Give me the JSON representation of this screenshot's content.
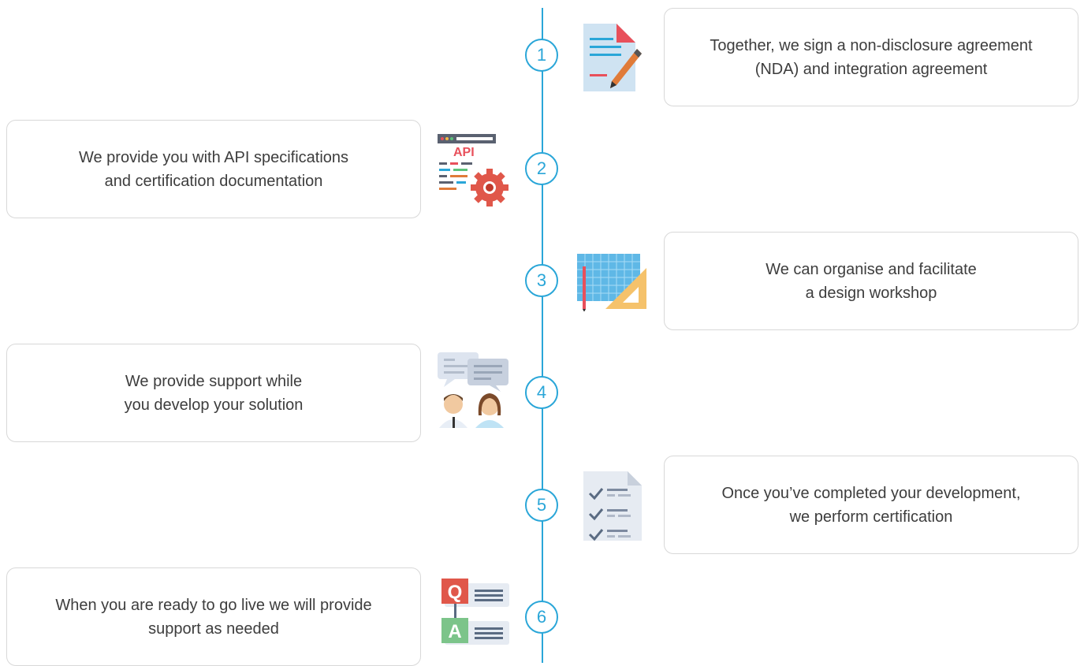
{
  "steps": [
    {
      "number": "1",
      "lines": [
        "Together, we sign a non-disclosure agreement",
        "(NDA) and integration agreement"
      ],
      "icon": "document-pen-icon"
    },
    {
      "number": "2",
      "lines": [
        "We provide you with API specifications",
        "and certification documentation"
      ],
      "icon": "api-gear-icon",
      "icon_text": "API"
    },
    {
      "number": "3",
      "lines": [
        "We can organise and facilitate",
        "a design workshop"
      ],
      "icon": "blueprint-ruler-icon"
    },
    {
      "number": "4",
      "lines": [
        "We provide support while",
        "you develop your solution"
      ],
      "icon": "support-chat-people-icon"
    },
    {
      "number": "5",
      "lines": [
        "Once you’ve completed your development,",
        "we perform certification"
      ],
      "icon": "checklist-icon"
    },
    {
      "number": "6",
      "lines": [
        "When you are ready to go live we will provide",
        "support as needed"
      ],
      "icon": "qa-icon",
      "icon_text": [
        "Q",
        "A"
      ]
    }
  ],
  "colors": {
    "accent": "#2aa6d8",
    "card_border": "#d8d8d8",
    "text": "#3d3d3d"
  }
}
